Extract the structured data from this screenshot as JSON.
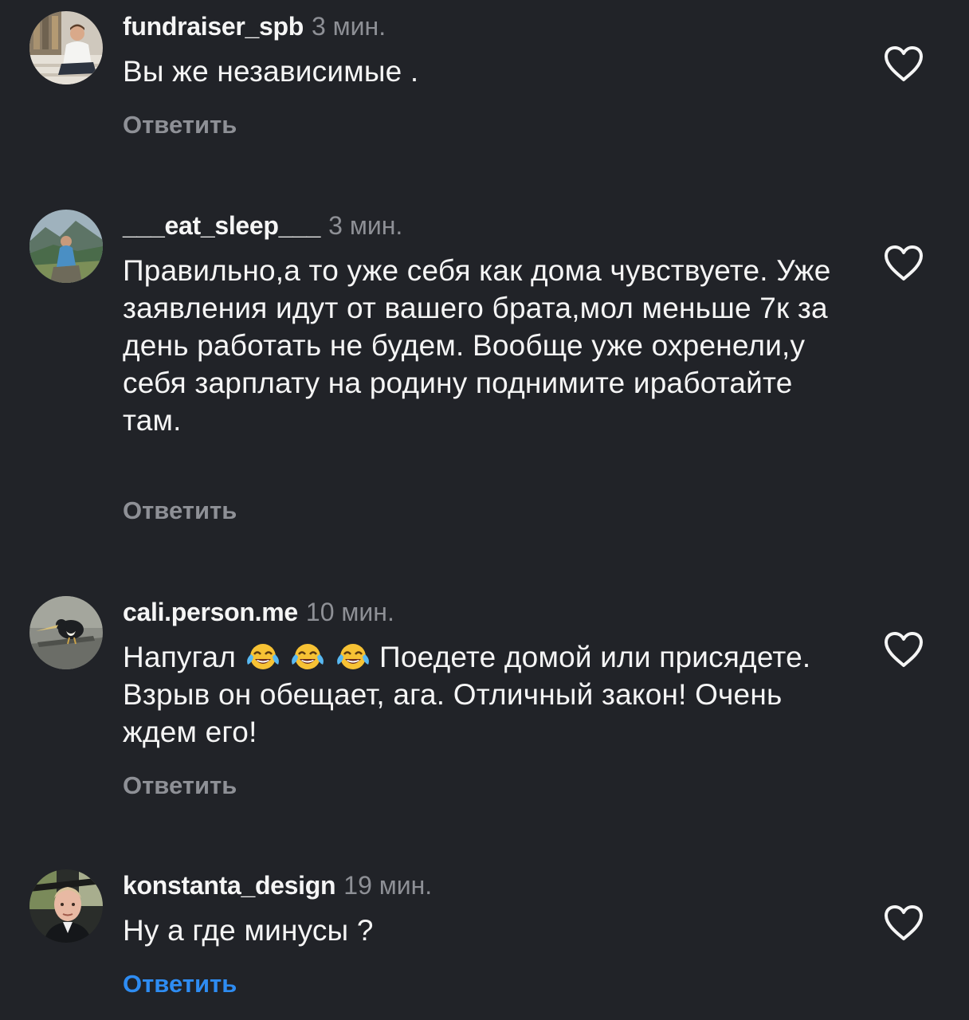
{
  "comments": [
    {
      "username": "fundraiser_spb",
      "time": "3 мин.",
      "text": "Вы же независимые .",
      "reply": "Ответить",
      "avatar_icon": "avatar-man-on-steps",
      "like_icon": "heart-outline-icon"
    },
    {
      "username": "___eat_sleep___",
      "time": "3 мин.",
      "text": "Правильно,а то уже себя как дома чувствуете. Уже заявления идут от вашего брата,мол меньше 7к за день работать не будем. Вообще уже охренели,у себя зарплату на родину поднимите иработайте там.",
      "reply": "Ответить",
      "avatar_icon": "avatar-hiker-mountains",
      "like_icon": "heart-outline-icon"
    },
    {
      "username": "cali.person.me",
      "time": "10 мин.",
      "text_before_emoji": "Напугал",
      "emoji": [
        "😂",
        "😂",
        "😂"
      ],
      "text_after_emoji": "Поедете домой или присядете. Взрыв он обещает, ага. Отличный закон! Очень ждем его!",
      "reply": "Ответить",
      "avatar_icon": "avatar-toucan",
      "like_icon": "heart-outline-icon"
    },
    {
      "username": "konstanta_design",
      "time": "19 мин.",
      "text": "Ну а где минусы ?",
      "reply": "Ответить",
      "reply_color": "#2e8cf2",
      "avatar_icon": "avatar-man-in-car",
      "like_icon": "heart-outline-icon"
    }
  ],
  "colors": {
    "background": "#212328",
    "primary_text": "#f5f5f5",
    "secondary_text": "#8e9096",
    "accent": "#2e8cf2"
  }
}
